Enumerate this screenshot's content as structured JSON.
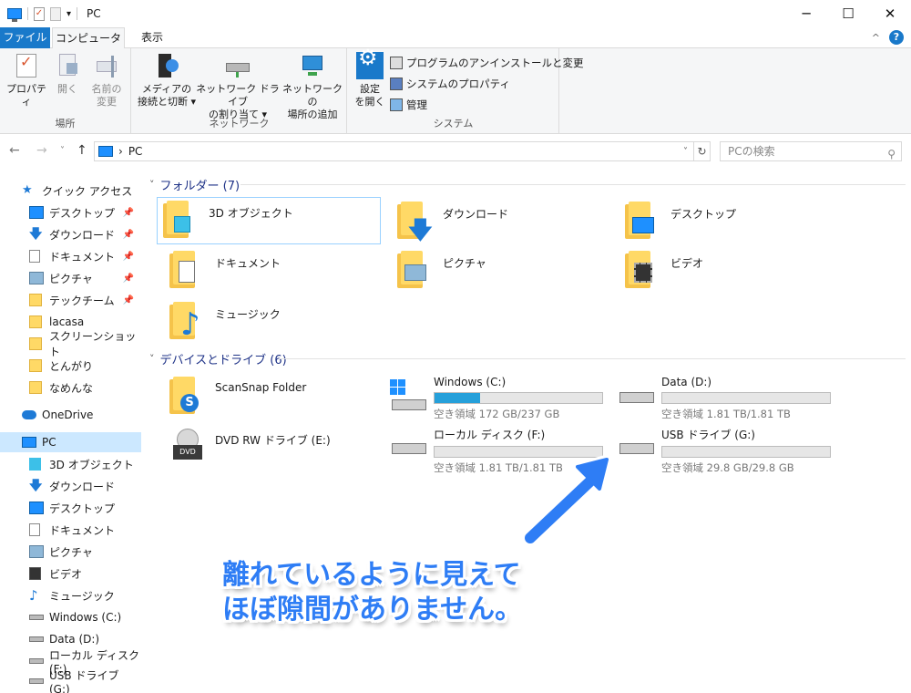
{
  "titlebar": {
    "title": "PC",
    "minimize": "─",
    "maximize": "☐",
    "close": "✕"
  },
  "tabs": {
    "file": "ファイル",
    "computer": "コンピューター",
    "view": "表示"
  },
  "ribbon": {
    "location": {
      "label": "場所",
      "properties": "プロパティ",
      "open": "開く",
      "rename_1": "名前の",
      "rename_2": "変更"
    },
    "network": {
      "label": "ネットワーク",
      "media_1": "メディアの",
      "media_2": "接続と切断 ▾",
      "map_1": "ネットワーク ドライブ",
      "map_2": "の割り当て ▾",
      "add_1": "ネットワークの",
      "add_2": "場所の追加"
    },
    "system": {
      "label": "システム",
      "settings_1": "設定",
      "settings_2": "を開く",
      "uninstall": "プログラムのアンインストールと変更",
      "sys_props": "システムのプロパティ",
      "manage": "管理"
    }
  },
  "address": {
    "crumb_sep": "›",
    "path": "PC",
    "search_placeholder": "PCの検索"
  },
  "sidebar": {
    "quick_access": "クイック アクセス",
    "quick_items": [
      {
        "label": "デスクトップ"
      },
      {
        "label": "ダウンロード"
      },
      {
        "label": "ドキュメント"
      },
      {
        "label": "ピクチャ"
      },
      {
        "label": "テックチーム"
      },
      {
        "label": "lacasa"
      },
      {
        "label": "スクリーンショット"
      },
      {
        "label": "とんがり"
      },
      {
        "label": "なめんな"
      }
    ],
    "onedrive": "OneDrive",
    "pc": "PC",
    "pc_items": [
      {
        "label": "3D オブジェクト"
      },
      {
        "label": "ダウンロード"
      },
      {
        "label": "デスクトップ"
      },
      {
        "label": "ドキュメント"
      },
      {
        "label": "ピクチャ"
      },
      {
        "label": "ビデオ"
      },
      {
        "label": "ミュージック"
      },
      {
        "label": "Windows (C:)"
      },
      {
        "label": "Data (D:)"
      },
      {
        "label": "ローカル ディスク (F:)"
      },
      {
        "label": "USB ドライブ (G:)"
      }
    ]
  },
  "folders": {
    "header": "フォルダー (7)",
    "items": [
      {
        "label": "3D オブジェクト"
      },
      {
        "label": "ダウンロード"
      },
      {
        "label": "デスクトップ"
      },
      {
        "label": "ドキュメント"
      },
      {
        "label": "ピクチャ"
      },
      {
        "label": "ビデオ"
      },
      {
        "label": "ミュージック"
      }
    ]
  },
  "devices": {
    "header": "デバイスとドライブ (6)",
    "scansnap": "ScanSnap Folder",
    "dvd": "DVD RW ドライブ (E:)",
    "dvd_badge": "DVD",
    "drives": [
      {
        "name": "Windows (C:)",
        "free": "空き領域 172 GB/237 GB",
        "used_fraction": 0.27
      },
      {
        "name": "Data (D:)",
        "free": "空き領域 1.81 TB/1.81 TB",
        "used_fraction": 0.0
      },
      {
        "name": "ローカル ディスク (F:)",
        "free": "空き領域 1.81 TB/1.81 TB",
        "used_fraction": 0.0
      },
      {
        "name": "USB ドライブ (G:)",
        "free": "空き領域 29.8 GB/29.8 GB",
        "used_fraction": 0.0
      }
    ]
  },
  "annotation": {
    "line1": "離れているように見えて",
    "line2": "ほぼ隙間がありません。"
  },
  "colors": {
    "accent": "#1979ca",
    "annotation": "#2e7df5",
    "bar_fill": "#26a0da",
    "folder": "#ffd966"
  }
}
